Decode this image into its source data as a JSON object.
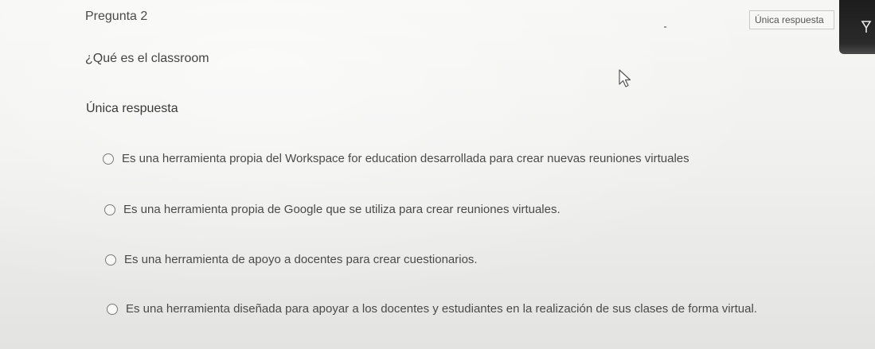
{
  "question": {
    "title": "Pregunta 2",
    "type_badge": "Única respuesta",
    "text": "¿Qué es el classroom",
    "answer_type_label": "Única respuesta"
  },
  "options": [
    {
      "label": "Es una herramienta propia del Workspace for education desarrollada para crear nuevas reuniones virtuales",
      "selected": false
    },
    {
      "label": "Es una herramienta propia de Google que se utiliza para crear reuniones virtuales.",
      "selected": false
    },
    {
      "label": "Es una herramienta de apoyo a docentes para crear cuestionarios.",
      "selected": false
    },
    {
      "label": "Es una herramienta diseñada para apoyar a los docentes y estudiantes en la realización de sus clases de forma virtual.",
      "selected": false
    }
  ],
  "icons": {
    "cursor": "mouse-pointer-icon",
    "corner": "corner-widget-icon"
  },
  "colors": {
    "background": "#f0f0ee",
    "text": "#4a4a4a",
    "corner_widget": "#1d1d1d"
  }
}
